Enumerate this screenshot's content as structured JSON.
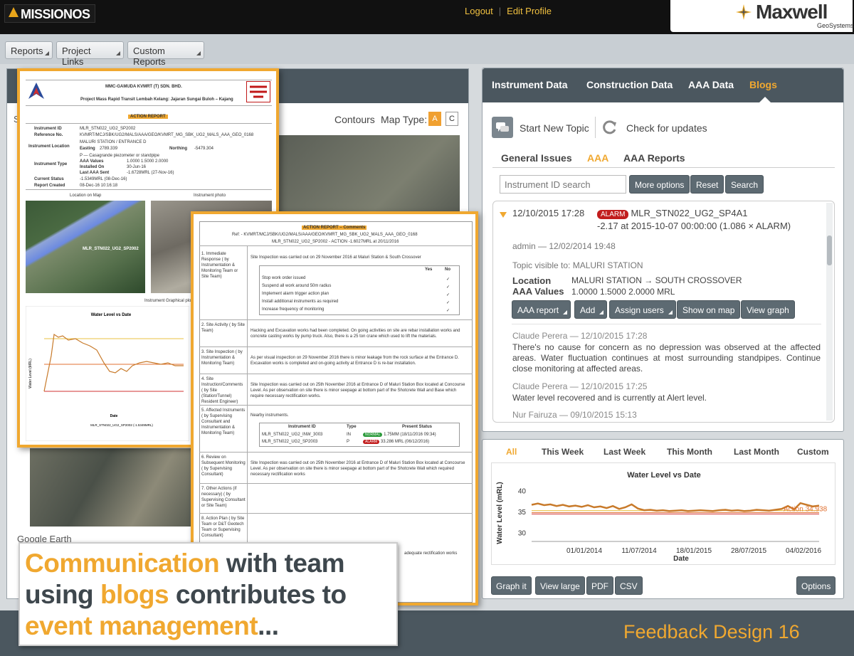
{
  "app": {
    "logo": "MISSIONOS",
    "logout": "Logout",
    "edit_profile": "Edit Profile",
    "brand": "Maxwell",
    "brand_sub": "GeoSystems"
  },
  "toolbar": {
    "reports": "Reports",
    "project_links": "Project Links",
    "custom_reports": "Custom Reports"
  },
  "map": {
    "contours": "Contours",
    "map_type": "Map Type:",
    "type_a": "A",
    "type_c": "C",
    "google_earth": "Google Earth",
    "left_stub": "S"
  },
  "right": {
    "tabs": [
      "Instrument Data",
      "Construction Data",
      "AAA Data",
      "Blogs"
    ],
    "start_topic": "Start New Topic",
    "check_updates": "Check for updates",
    "subtabs": [
      "General Issues",
      "AAA",
      "AAA Reports"
    ],
    "search_placeholder": "Instrument ID search",
    "more_options": "More options",
    "reset": "Reset",
    "search": "Search"
  },
  "blog": {
    "timestamp": "12/10/2015 17:28",
    "alarm": "ALARM",
    "instrument": "MLR_STN022_UG2_SP4A1",
    "reading": "-2.17 at 2015-10-07 00:00:00 (1.086 × ALARM)",
    "author": "admin — 12/02/2014 19:48",
    "visible": "Topic visible to: MALURI STATION",
    "location_label": "Location",
    "location_value": "MALURI STATION → SOUTH CROSSOVER",
    "aaa_label": "AAA Values",
    "aaa_value": "1.0000 1.5000 2.0000 MRL",
    "buttons": [
      "AAA report",
      "Add",
      "Assign users",
      "Show on map",
      "View graph"
    ],
    "comments": [
      {
        "author": "Claude Perera — 12/10/2015 17:28",
        "text": "There's no cause for concern as no depression was observed at the affected areas. Water fluctuation continues at most surrounding standpipes. Continue close monitoring at affected areas."
      },
      {
        "author": "Claude Perera — 12/10/2015 17:25",
        "text": "Water level recovered and is currently at Alert level."
      },
      {
        "author": "Nur Fairuza — 09/10/2015 15:13",
        "text": ""
      }
    ]
  },
  "graph": {
    "tabs": [
      "All",
      "This Week",
      "Last Week",
      "This Month",
      "Last Month",
      "Custom"
    ],
    "buttons": [
      "Graph it",
      "View large",
      "PDF",
      "CSV"
    ],
    "options": "Options"
  },
  "chart_data": {
    "type": "line",
    "title": "Water Level vs Date",
    "xlabel": "Date",
    "ylabel": "Water Level (mRL)",
    "ylim": [
      28,
      42
    ],
    "yticks": [
      30,
      35,
      40
    ],
    "xticks": [
      "01/01/2014",
      "11/07/2014",
      "18/01/2015",
      "28/07/2015",
      "04/02/2016"
    ],
    "annotation": "Action 34.938",
    "threshold_colors": {
      "alert": "#e8c040",
      "action": "#e07030",
      "alarm": "#d03030"
    },
    "series": [
      {
        "values": [
          36.8,
          37.1,
          36.7,
          36.9,
          36.5,
          36.8,
          36.4,
          36.6,
          36.3,
          36.7,
          36.2,
          36.4,
          36.0,
          36.5,
          35.8,
          36.2,
          36.9,
          35.9,
          35.5,
          35.6,
          35.4,
          35.5,
          35.3,
          35.4,
          35.5,
          35.3,
          35.4,
          35.5,
          35.4,
          35.3,
          35.5,
          35.6,
          35.4,
          35.5,
          35.3,
          35.4,
          35.6,
          35.5,
          35.4,
          35.6,
          35.8,
          36.5,
          35.7,
          37.2,
          36.8,
          36.4,
          36.6
        ]
      }
    ]
  },
  "report_doc": {
    "company": "MMC-GAMUDA KVMRT (T) SDN. BHD.",
    "project": "Project Mass Rapid Transit Lembah Kelang: Jajaran Sungai Buloh – Kajang",
    "title": "ACTION REPORT",
    "rows": [
      [
        "Instrument ID",
        "MLR_STN022_UG2_SP2002"
      ],
      [
        "Reference No.",
        "KVMRT/MCJ/SBK/UG2/MALS/AAA/GEO/KVMRT_MG_SBK_UG2_MALS_AAA_GEO_0168"
      ],
      [
        "Instrument Location",
        "MALURI STATION / ENTRANCE D"
      ],
      [
        "Instrument Type",
        "P — Casagrande piezometer or standpipe"
      ],
      [
        "Current Status",
        "-1.5349MRL (08-Dec-16)"
      ],
      [
        "Report Created",
        "08-Dec-16 10:16:18"
      ]
    ],
    "easting": "Easting",
    "easting_val": "2789.339",
    "northing": "Northing",
    "northing_val": "-5479.304",
    "aaa_values": "AAA Values",
    "aaa_nums": "1.0000   1.5000   2.0000",
    "installed": "Installed On",
    "installed_val": "30-Jun-16",
    "last_aaa": "Last AAA Sent",
    "last_aaa_val": "-1.6728MRL (27-Nov-16)",
    "loc_map": "Location on Map",
    "inst_photo": "Instrument photo",
    "map_label": "MLR_STN022_UG2_SP2002",
    "graph_title": "Instrument Graphical plot",
    "chart_title": "Water Level vs Date",
    "chart_ylabel": "Water Level (MRL)",
    "chart_xlabel": "Date",
    "chart_legend": "MLR_STN022_UG2_SP2002 (-1.5349MRL)"
  },
  "comments_doc": {
    "title": "ACTION REPORT – Comments",
    "ref": "Ref: - KVMRT/MCJ/SBK/UG2/MALS/AAA/GEO/KVMRT_MG_SBK_UG2_MALS_AAA_GEO_0168",
    "instrument": "MLR_STN022_UG2_SP2002 - ACTION -1.6027MRL at 20/11/2016",
    "sections": [
      {
        "label": "1. Immediate Response ( by Instrumentation & Monitoring Team or Site Team)",
        "note": "Site Inspection was carried out on 29 November 2016 at Maluri Station & South Crossover"
      },
      {
        "label": "2. Site Activity ( by Site Team)",
        "note": "Hacking and Excavation works had been completed. On going activities on site are rebar installation works and concrete casting works by pump truck. Also, there is a 25 ton crane which used to lift the materials."
      },
      {
        "label": "3. Site Inspection ( by Instrumentation & Monitoring Team)",
        "note": "As per visual inspection on 29 November 2016 there is minor leakage from the rock surface at the Entrance D. Excavation works is completed and on-going activity at Entrance D is re-bar installation."
      },
      {
        "label": "4. Site Instruction/Comments ( by Site (Station/Tunnel) Resident Engineer)",
        "note": "Site Inspection was carried out on 25th November 2016 at Entrance D of Maluri Station Box located at Concourse Level. As per observation on site there is minor seepage at bottom part of the Shotcrete Wall and Base which require necessary rectification works."
      },
      {
        "label": "5. Affected Instruments ( by Supervising Consultant and Instrumentation & Monitoring Team)",
        "note": "Nearby instruments."
      },
      {
        "label": "6. Review on Subsequent Monitoring ( by Supervising Consultant)",
        "note": "Site Inspection was carried out on 25th November 2016 at Entrance D of Maluri Station Box located at Concourse Level. As per observation on site there is minor seepage at bottom part of the Shotcrete Wall which required necessary rectification works"
      },
      {
        "label": "7. Other Actions (if necessary) ( by Supervising Consultant or Site Team)",
        "note": ""
      },
      {
        "label": "8. Action Plan ( by Site Team or D&T Geotech Team or Supervising Consultant)",
        "note": ""
      }
    ],
    "checklist_head": [
      "Yes",
      "No"
    ],
    "checklist": [
      "Stop work order issued",
      "Suspend all work around 50m radius",
      "Implement alarm trigger action plan",
      "Install additional instruments as required",
      "Increase frequency of monitoring"
    ],
    "inst_table_head": [
      "Instrument ID",
      "Type",
      "Present Status"
    ],
    "inst_table": [
      [
        "MLR_STN022_UG2_INW_3003",
        "IN",
        "NORMAL",
        "1.75MM (18/11/2016 09:34)"
      ],
      [
        "MLR_STN022_UG2_SP2003",
        "P",
        "ALARM",
        "33.286 MRL (06/12/2016)"
      ]
    ],
    "bottom_note": "adequate rectification works"
  },
  "callout": {
    "w1": "Communication",
    "w2": " with team",
    "w3": "using ",
    "w4": "blogs",
    "w5": " contributes to",
    "w6": "event management",
    "w7": "..."
  },
  "footer": "Feedback Design 16"
}
